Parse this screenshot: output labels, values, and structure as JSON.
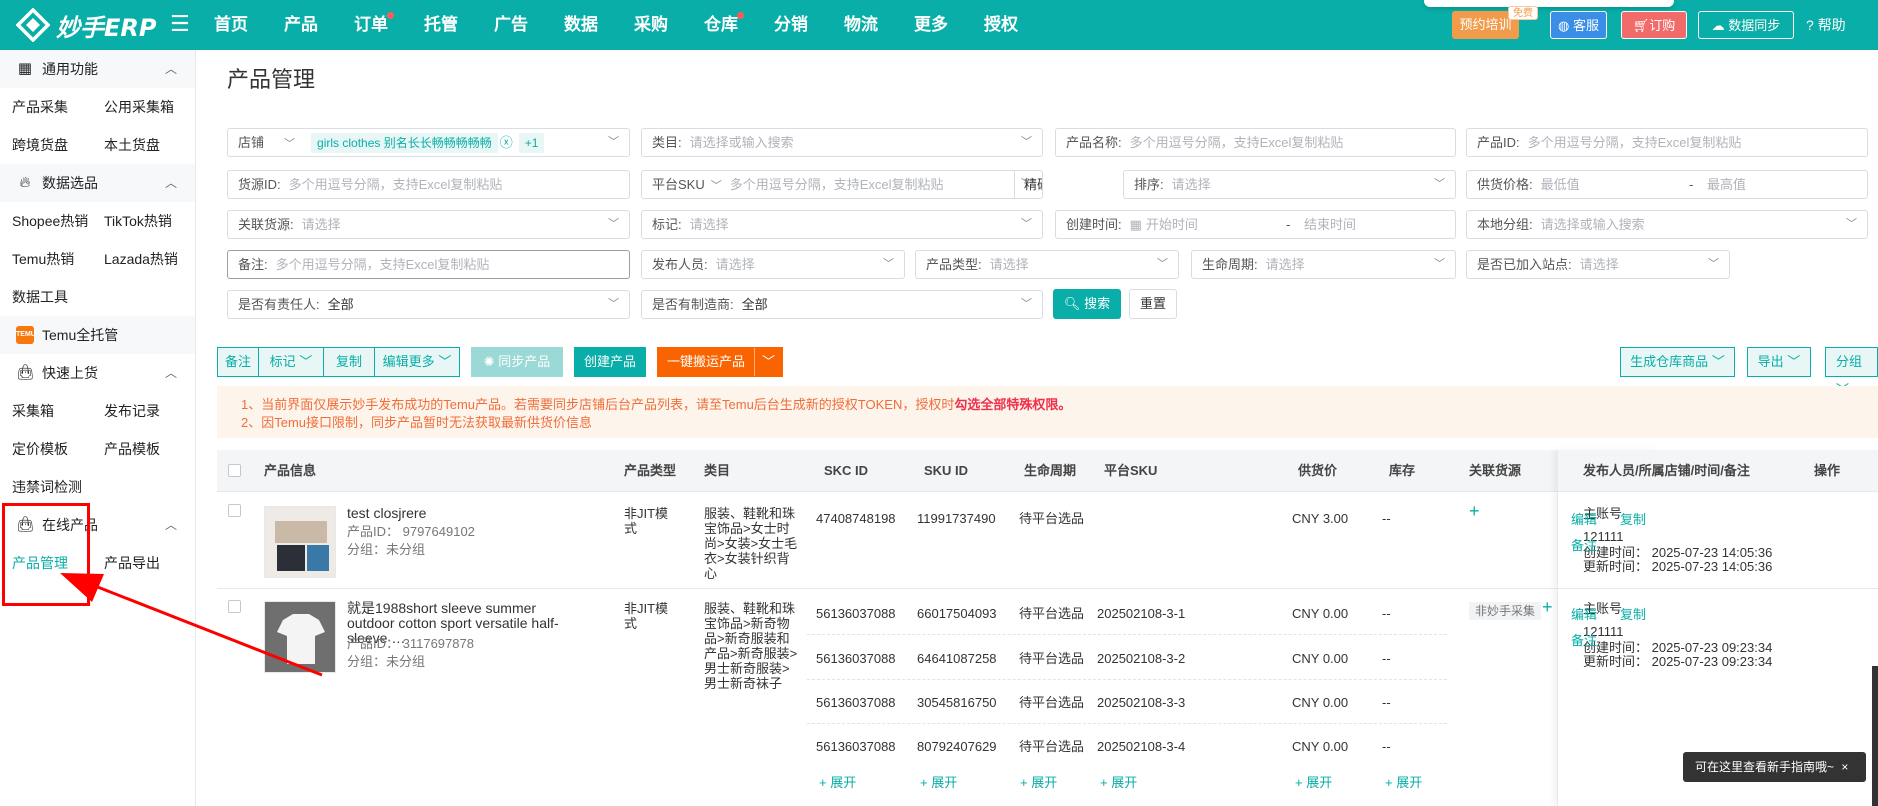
{
  "app": {
    "logo_text": "妙手ERP"
  },
  "nav": {
    "items": [
      {
        "label": "首页"
      },
      {
        "label": "产品"
      },
      {
        "label": "订单",
        "dot": true
      },
      {
        "label": "托管"
      },
      {
        "label": "广告"
      },
      {
        "label": "数据"
      },
      {
        "label": "采购"
      },
      {
        "label": "仓库",
        "dot": true
      },
      {
        "label": "分销"
      },
      {
        "label": "物流"
      },
      {
        "label": "更多"
      },
      {
        "label": "授权"
      }
    ]
  },
  "topright": {
    "training": "预约培训",
    "free_tag": "免费",
    "service": "客服",
    "order": "订购",
    "sync": "数据同步",
    "help": "帮助"
  },
  "sidebar": {
    "g1": {
      "title": "通用功能",
      "items": [
        "产品采集",
        "公用采集箱",
        "跨境货盘",
        "本土货盘"
      ]
    },
    "g2": {
      "title": "数据选品",
      "items": [
        "Shopee热销",
        "TikTok热销",
        "Temu热销",
        "Lazada热销",
        "数据工具"
      ]
    },
    "g3": {
      "title": "Temu全托管",
      "icon_text": "TEMU"
    },
    "g4": {
      "title": "快速上货",
      "items": [
        "采集箱",
        "发布记录",
        "定价模板",
        "产品模板",
        "违禁词检测"
      ]
    },
    "g5": {
      "title": "在线产品",
      "items": [
        "产品管理",
        "产品导出"
      ]
    }
  },
  "page": {
    "title": "产品管理"
  },
  "filters": {
    "shop": {
      "label": "店铺",
      "tag": "girls clothes 别名长长畅畅畅畅畅",
      "more": "+1"
    },
    "category": {
      "label": "类目:",
      "placeholder": "请选择或输入搜索"
    },
    "name": {
      "label": "产品名称:",
      "placeholder": "多个用逗号分隔，支持Excel复制粘贴"
    },
    "pid": {
      "label": "产品ID:",
      "placeholder": "多个用逗号分隔，支持Excel复制粘贴"
    },
    "source": {
      "label": "货源ID:",
      "placeholder": "多个用逗号分隔，支持Excel复制粘贴"
    },
    "psku": {
      "label": "平台SKU",
      "placeholder": "多个用逗号分隔，支持Excel复制粘贴",
      "match": "精确匹配"
    },
    "sort": {
      "label": "排序:",
      "placeholder": "请选择"
    },
    "price": {
      "label": "供货价格:",
      "min": "最低值",
      "sep": "-",
      "max": "最高值"
    },
    "linked": {
      "label": "关联货源:",
      "placeholder": "请选择"
    },
    "mark": {
      "label": "标记:",
      "placeholder": "请选择"
    },
    "created": {
      "label": "创建时间:",
      "start": "开始时间",
      "sep": "-",
      "end": "结束时间"
    },
    "group": {
      "label": "本地分组:",
      "placeholder": "请选择或输入搜索"
    },
    "remark": {
      "label": "备注:",
      "placeholder": "多个用逗号分隔，支持Excel复制粘贴"
    },
    "publisher": {
      "label": "发布人员:",
      "placeholder": "请选择"
    },
    "ptype": {
      "label": "产品类型:",
      "placeholder": "请选择"
    },
    "life": {
      "label": "生命周期:",
      "placeholder": "请选择"
    },
    "site": {
      "label": "是否已加入站点:",
      "placeholder": "请选择"
    },
    "owner": {
      "label": "是否有责任人:",
      "value": "全部"
    },
    "maker": {
      "label": "是否有制造商:",
      "value": "全部"
    },
    "search": "搜索",
    "reset": "重置"
  },
  "actions": {
    "remark": "备注",
    "mark": "标记",
    "copy": "复制",
    "edit_more": "编辑更多",
    "sync": "同步产品",
    "create": "创建产品",
    "move": "一键搬运产品",
    "gen_wh": "生成仓库商品",
    "export": "导出",
    "group": "分组"
  },
  "notice": {
    "line1a": "1、当前界面仅展示妙手发布成功的Temu产品。若需要同步店铺后台产品列表，请至Temu后台生成新的授权TOKEN，授权时",
    "line1b": "勾选全部特殊权限。",
    "line2": "2、因Temu接口限制，同步产品暂时无法获取最新供货价信息"
  },
  "table": {
    "headers": [
      "产品信息",
      "产品类型",
      "类目",
      "SKC ID",
      "SKU ID",
      "生命周期",
      "平台SKU",
      "供货价",
      "库存",
      "关联货源",
      "发布人员/所属店铺/时间/备注",
      "操作"
    ],
    "rows": [
      {
        "title": "test closjrere",
        "pid": "产品ID： 9797649102",
        "group": "分组：未分组",
        "type": "非JIT模式",
        "cat": "服装、鞋靴和珠宝饰品>女士时尚>女装>女士毛衣>女装针织背心",
        "skus": [
          {
            "skc": "47408748198",
            "sku": "11991737490",
            "life": "待平台选品",
            "psku": "",
            "price": "CNY 3.00",
            "stock": "--"
          }
        ],
        "linked_tag": "",
        "linked_plus": "+",
        "publisher": "主账号",
        "shop": "121111",
        "created": "创建时间：  2025-07-23 14:05:36",
        "updated": "更新时间：  2025-07-23 14:05:36",
        "ops": [
          "编辑",
          "复制",
          "备注"
        ]
      },
      {
        "title": "就是1988short sleeve summer outdoor cotton sport versatile half-sleeve …",
        "pid": "产品ID： 3117697878",
        "group": "分组：未分组",
        "type": "非JIT模式",
        "cat": "服装、鞋靴和珠宝饰品>新奇物品>新奇服装和产品>新奇服装>男士新奇服装>男士新奇袜子",
        "skus": [
          {
            "skc": "56136037088",
            "sku": "66017504093",
            "life": "待平台选品",
            "psku": "202502108-3-1",
            "price": "CNY 0.00",
            "stock": "--"
          },
          {
            "skc": "56136037088",
            "sku": "64641087258",
            "life": "待平台选品",
            "psku": "202502108-3-2",
            "price": "CNY 0.00",
            "stock": "--"
          },
          {
            "skc": "56136037088",
            "sku": "30545816750",
            "life": "待平台选品",
            "psku": "202502108-3-3",
            "price": "CNY 0.00",
            "stock": "--"
          },
          {
            "skc": "56136037088",
            "sku": "80792407629",
            "life": "待平台选品",
            "psku": "202502108-3-4",
            "price": "CNY 0.00",
            "stock": "--"
          }
        ],
        "expand": "+ 展开",
        "linked_tag": "非妙手采集",
        "linked_plus": "+",
        "publisher": "主账号",
        "shop": "121111",
        "created": "创建时间：  2025-07-23 09:23:34",
        "updated": "更新时间：  2025-07-23 09:23:34",
        "ops": [
          "编辑",
          "复制",
          "备注"
        ]
      }
    ]
  },
  "toast": {
    "text": "可在这里查看新手指南哦~",
    "close": "×"
  },
  "colors": {
    "brand": "#08aea7",
    "highlight": "#ff0000",
    "notice": "#f06d3a"
  }
}
